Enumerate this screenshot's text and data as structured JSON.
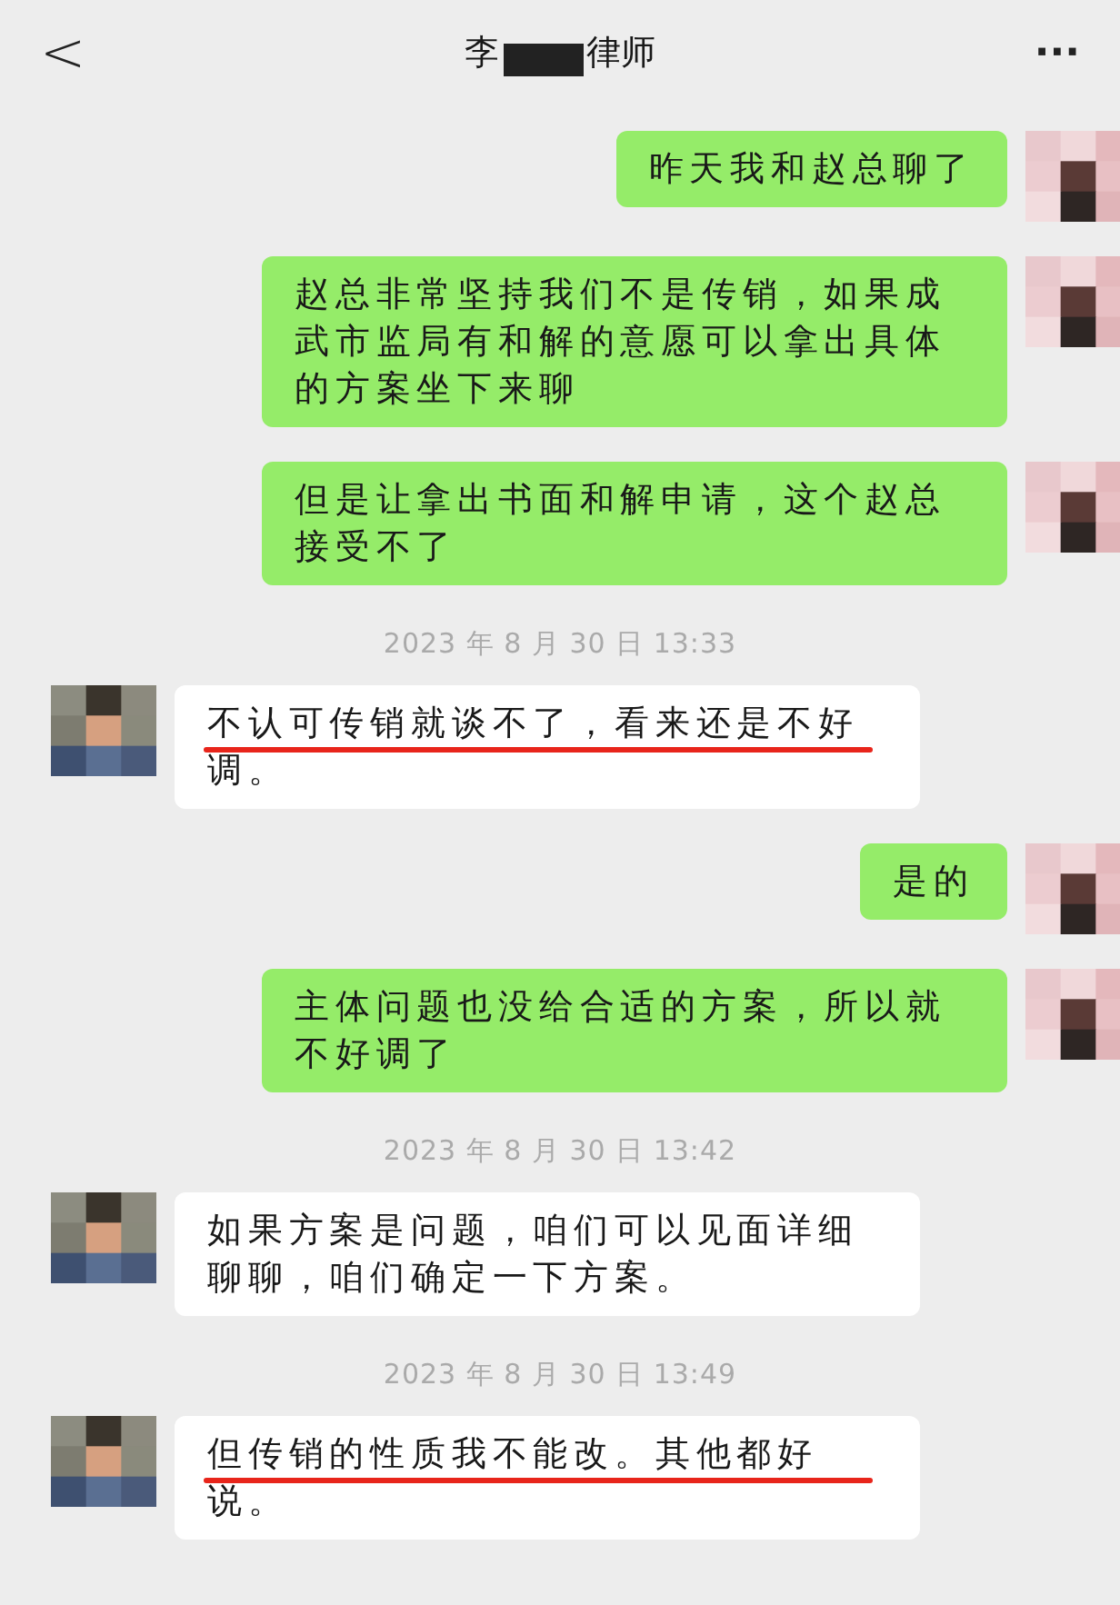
{
  "header": {
    "back": "<",
    "title_start": "李",
    "title_end": "律师",
    "more": "···"
  },
  "messages": [
    {
      "kind": "outgoing",
      "text": "昨天我和赵总聊了",
      "underlined": false
    },
    {
      "kind": "outgoing",
      "text": "赵总非常坚持我们不是传销，如果成武市监局有和解的意愿可以拿出具体的方案坐下来聊",
      "underlined": false
    },
    {
      "kind": "outgoing",
      "text": "但是让拿出书面和解申请，这个赵总接受不了",
      "underlined": false
    },
    {
      "kind": "time",
      "text": "2023 年 8 月 30 日 13:33"
    },
    {
      "kind": "incoming",
      "text": "不认可传销就谈不了，看来还是不好调。",
      "underlined": true
    },
    {
      "kind": "outgoing",
      "text": "是的",
      "underlined": false
    },
    {
      "kind": "outgoing",
      "text": "主体问题也没给合适的方案，所以就不好调了",
      "underlined": false
    },
    {
      "kind": "time",
      "text": "2023 年 8 月 30 日 13:42"
    },
    {
      "kind": "incoming",
      "text": "如果方案是问题，咱们可以见面详细聊聊，咱们确定一下方案。",
      "underlined": false
    },
    {
      "kind": "time",
      "text": "2023 年 8 月 30 日 13:49"
    },
    {
      "kind": "incoming",
      "text": "但传销的性质我不能改。其他都好说。",
      "underlined": true
    }
  ]
}
